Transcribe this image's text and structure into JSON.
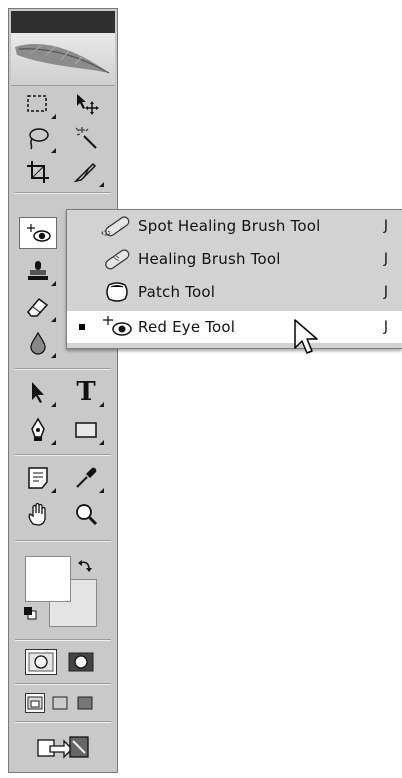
{
  "toolbox": {
    "tools": [
      {
        "id": "rect-marquee",
        "icon": "rectangular-marquee-icon"
      },
      {
        "id": "move",
        "icon": "move-icon"
      },
      {
        "id": "lasso",
        "icon": "lasso-icon"
      },
      {
        "id": "magic-wand",
        "icon": "magic-wand-icon"
      },
      {
        "id": "crop",
        "icon": "crop-icon"
      },
      {
        "id": "slice",
        "icon": "slice-icon"
      },
      {
        "id": "red-eye",
        "icon": "red-eye-icon"
      },
      {
        "id": "clone-stamp",
        "icon": "clone-stamp-icon"
      },
      {
        "id": "eraser",
        "icon": "eraser-icon"
      },
      {
        "id": "blur",
        "icon": "blur-drop-icon"
      },
      {
        "id": "path-selection",
        "icon": "path-selection-icon"
      },
      {
        "id": "type",
        "icon": "type-icon",
        "glyph": "T"
      },
      {
        "id": "pen",
        "icon": "pen-icon"
      },
      {
        "id": "rectangle-shape",
        "icon": "rectangle-shape-icon"
      },
      {
        "id": "notes",
        "icon": "notes-icon"
      },
      {
        "id": "eyedropper",
        "icon": "eyedropper-icon"
      },
      {
        "id": "hand",
        "icon": "hand-icon"
      },
      {
        "id": "zoom",
        "icon": "zoom-icon"
      }
    ],
    "colors": {
      "foreground": "#ffffff",
      "background": "#e4e4e4"
    },
    "modes": [
      "standard-mode",
      "quick-mask-mode"
    ],
    "screen_modes": [
      "standard-screen",
      "full-screen-menu",
      "full-screen"
    ],
    "jump_to": "imageready-jump"
  },
  "flyout": {
    "items": [
      {
        "label": "Spot Healing Brush Tool",
        "shortcut": "J",
        "icon": "spot-healing-brush-icon",
        "selected": false
      },
      {
        "label": "Healing Brush Tool",
        "shortcut": "J",
        "icon": "healing-brush-icon",
        "selected": false
      },
      {
        "label": "Patch Tool",
        "shortcut": "J",
        "icon": "patch-icon",
        "selected": false
      },
      {
        "label": "Red Eye Tool",
        "shortcut": "J",
        "icon": "red-eye-icon",
        "selected": true
      }
    ]
  }
}
